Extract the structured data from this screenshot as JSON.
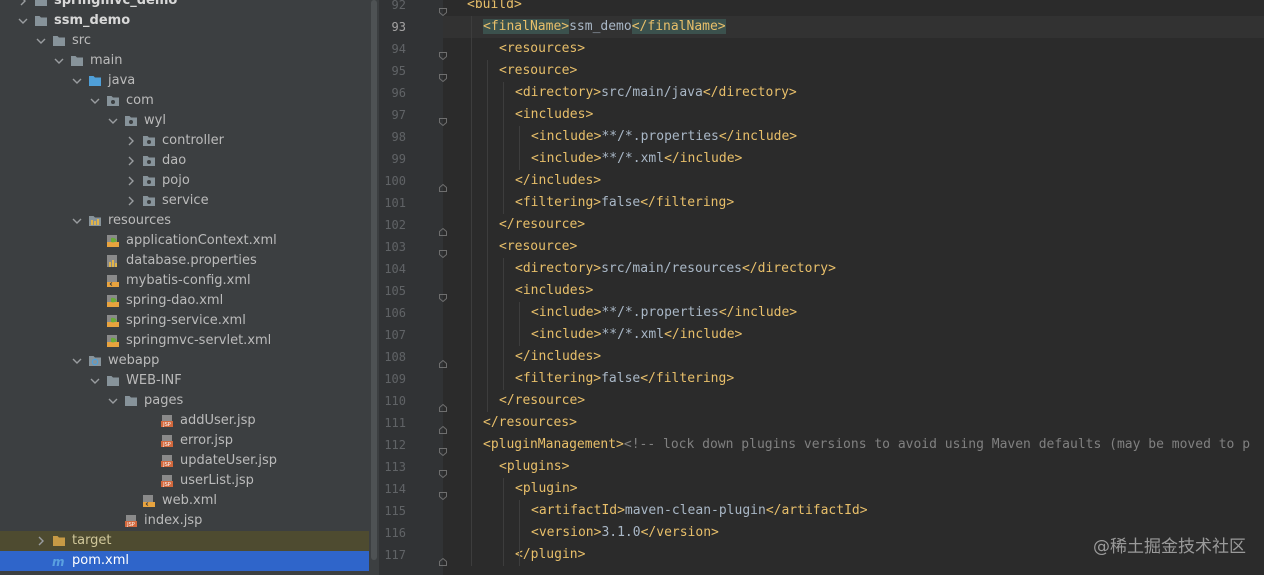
{
  "colors": {
    "folder": "#87939a",
    "source_folder": "#4f9fd8",
    "xml": "#e8a33e",
    "jsp": "#d2683d",
    "selected": "#2f65ca",
    "excluded": "#4e4b30"
  },
  "tree": [
    {
      "label": "springmvc_demo",
      "depth": 0,
      "chevron": "right",
      "icon": "folder",
      "bold": true
    },
    {
      "label": "ssm_demo",
      "depth": 0,
      "chevron": "down",
      "icon": "folder",
      "bold": true
    },
    {
      "label": "src",
      "depth": 1,
      "chevron": "down",
      "icon": "folder"
    },
    {
      "label": "main",
      "depth": 2,
      "chevron": "down",
      "icon": "folder"
    },
    {
      "label": "java",
      "depth": 3,
      "chevron": "down",
      "icon": "source-folder"
    },
    {
      "label": "com",
      "depth": 4,
      "chevron": "down",
      "icon": "package"
    },
    {
      "label": "wyl",
      "depth": 5,
      "chevron": "down",
      "icon": "package"
    },
    {
      "label": "controller",
      "depth": 6,
      "chevron": "right",
      "icon": "package"
    },
    {
      "label": "dao",
      "depth": 6,
      "chevron": "right",
      "icon": "package"
    },
    {
      "label": "pojo",
      "depth": 6,
      "chevron": "right",
      "icon": "package"
    },
    {
      "label": "service",
      "depth": 6,
      "chevron": "right",
      "icon": "package"
    },
    {
      "label": "resources",
      "depth": 3,
      "chevron": "down",
      "icon": "resources-folder"
    },
    {
      "label": "applicationContext.xml",
      "depth": 4,
      "chevron": "none",
      "icon": "spring-xml"
    },
    {
      "label": "database.properties",
      "depth": 4,
      "chevron": "none",
      "icon": "properties"
    },
    {
      "label": "mybatis-config.xml",
      "depth": 4,
      "chevron": "none",
      "icon": "xml"
    },
    {
      "label": "spring-dao.xml",
      "depth": 4,
      "chevron": "none",
      "icon": "spring-xml"
    },
    {
      "label": "spring-service.xml",
      "depth": 4,
      "chevron": "none",
      "icon": "spring-xml"
    },
    {
      "label": "springmvc-servlet.xml",
      "depth": 4,
      "chevron": "none",
      "icon": "spring-xml"
    },
    {
      "label": "webapp",
      "depth": 3,
      "chevron": "down",
      "icon": "web-folder"
    },
    {
      "label": "WEB-INF",
      "depth": 4,
      "chevron": "down",
      "icon": "folder"
    },
    {
      "label": "pages",
      "depth": 5,
      "chevron": "down",
      "icon": "folder"
    },
    {
      "label": "addUser.jsp",
      "depth": 7,
      "chevron": "none",
      "icon": "jsp"
    },
    {
      "label": "error.jsp",
      "depth": 7,
      "chevron": "none",
      "icon": "jsp"
    },
    {
      "label": "updateUser.jsp",
      "depth": 7,
      "chevron": "none",
      "icon": "jsp"
    },
    {
      "label": "userList.jsp",
      "depth": 7,
      "chevron": "none",
      "icon": "jsp"
    },
    {
      "label": "web.xml",
      "depth": 6,
      "chevron": "none",
      "icon": "web-xml"
    },
    {
      "label": "index.jsp",
      "depth": 5,
      "chevron": "none",
      "icon": "jsp"
    },
    {
      "label": "target",
      "depth": 1,
      "chevron": "right",
      "icon": "excluded-folder",
      "state": "excluded"
    },
    {
      "label": "pom.xml",
      "depth": 1,
      "chevron": "none",
      "icon": "maven",
      "state": "selected"
    }
  ],
  "editor": {
    "current_line": 93,
    "lines": [
      {
        "num": 92,
        "indent": 1,
        "fold": "open",
        "tokens": [
          [
            "tag",
            "<build>"
          ]
        ]
      },
      {
        "num": 93,
        "indent": 2,
        "fold": "none",
        "tokens": [
          [
            "tag-hl",
            "<finalName>"
          ],
          [
            "txt",
            "ssm_demo"
          ],
          [
            "tag-hl",
            "</finalName>"
          ]
        ]
      },
      {
        "num": 94,
        "indent": 3,
        "fold": "open",
        "tokens": [
          [
            "tag",
            "<resources>"
          ]
        ]
      },
      {
        "num": 95,
        "indent": 3,
        "fold": "open",
        "tokens": [
          [
            "tag",
            "<resource>"
          ]
        ]
      },
      {
        "num": 96,
        "indent": 4,
        "fold": "none",
        "tokens": [
          [
            "tag",
            "<directory>"
          ],
          [
            "txt",
            "src/main/java"
          ],
          [
            "tag",
            "</directory>"
          ]
        ]
      },
      {
        "num": 97,
        "indent": 4,
        "fold": "open",
        "tokens": [
          [
            "tag",
            "<includes>"
          ]
        ]
      },
      {
        "num": 98,
        "indent": 5,
        "fold": "none",
        "tokens": [
          [
            "tag",
            "<include>"
          ],
          [
            "txt",
            "**/*.properties"
          ],
          [
            "tag",
            "</include>"
          ]
        ]
      },
      {
        "num": 99,
        "indent": 5,
        "fold": "none",
        "tokens": [
          [
            "tag",
            "<include>"
          ],
          [
            "txt",
            "**/*.xml"
          ],
          [
            "tag",
            "</include>"
          ]
        ]
      },
      {
        "num": 100,
        "indent": 4,
        "fold": "close",
        "tokens": [
          [
            "tag",
            "</includes>"
          ]
        ]
      },
      {
        "num": 101,
        "indent": 4,
        "fold": "none",
        "tokens": [
          [
            "tag",
            "<filtering>"
          ],
          [
            "txt",
            "false"
          ],
          [
            "tag",
            "</filtering>"
          ]
        ]
      },
      {
        "num": 102,
        "indent": 3,
        "fold": "close",
        "tokens": [
          [
            "tag",
            "</resource>"
          ]
        ]
      },
      {
        "num": 103,
        "indent": 3,
        "fold": "open",
        "tokens": [
          [
            "tag",
            "<resource>"
          ]
        ]
      },
      {
        "num": 104,
        "indent": 4,
        "fold": "none",
        "tokens": [
          [
            "tag",
            "<directory>"
          ],
          [
            "txt",
            "src/main/resources"
          ],
          [
            "tag",
            "</directory>"
          ]
        ]
      },
      {
        "num": 105,
        "indent": 4,
        "fold": "open",
        "tokens": [
          [
            "tag",
            "<includes>"
          ]
        ]
      },
      {
        "num": 106,
        "indent": 5,
        "fold": "none",
        "tokens": [
          [
            "tag",
            "<include>"
          ],
          [
            "txt",
            "**/*.properties"
          ],
          [
            "tag",
            "</include>"
          ]
        ]
      },
      {
        "num": 107,
        "indent": 5,
        "fold": "none",
        "tokens": [
          [
            "tag",
            "<include>"
          ],
          [
            "txt",
            "**/*.xml"
          ],
          [
            "tag",
            "</include>"
          ]
        ]
      },
      {
        "num": 108,
        "indent": 4,
        "fold": "close",
        "tokens": [
          [
            "tag",
            "</includes>"
          ]
        ]
      },
      {
        "num": 109,
        "indent": 4,
        "fold": "none",
        "tokens": [
          [
            "tag",
            "<filtering>"
          ],
          [
            "txt",
            "false"
          ],
          [
            "tag",
            "</filtering>"
          ]
        ]
      },
      {
        "num": 110,
        "indent": 3,
        "fold": "close",
        "tokens": [
          [
            "tag",
            "</resource>"
          ]
        ]
      },
      {
        "num": 111,
        "indent": 2,
        "fold": "close",
        "tokens": [
          [
            "tag",
            "</resources>"
          ]
        ]
      },
      {
        "num": 112,
        "indent": 2,
        "fold": "open",
        "tokens": [
          [
            "tag",
            "<pluginManagement>"
          ],
          [
            "cmt",
            "<!-- lock down plugins versions to avoid using Maven defaults (may be moved to p"
          ]
        ]
      },
      {
        "num": 113,
        "indent": 3,
        "fold": "open",
        "tokens": [
          [
            "tag",
            "<plugins>"
          ]
        ]
      },
      {
        "num": 114,
        "indent": 4,
        "fold": "open",
        "tokens": [
          [
            "tag",
            "<plugin>"
          ]
        ]
      },
      {
        "num": 115,
        "indent": 5,
        "fold": "none",
        "tokens": [
          [
            "tag",
            "<artifactId>"
          ],
          [
            "txt",
            "maven-clean-plugin"
          ],
          [
            "tag",
            "</artifactId>"
          ]
        ]
      },
      {
        "num": 116,
        "indent": 5,
        "fold": "none",
        "tokens": [
          [
            "tag",
            "<version>"
          ],
          [
            "txt",
            "3.1.0"
          ],
          [
            "tag",
            "</version>"
          ]
        ]
      },
      {
        "num": 117,
        "indent": 4,
        "fold": "close",
        "tokens": [
          [
            "tag",
            "</plugin>"
          ]
        ]
      }
    ]
  },
  "watermark": "@稀土掘金技术社区"
}
